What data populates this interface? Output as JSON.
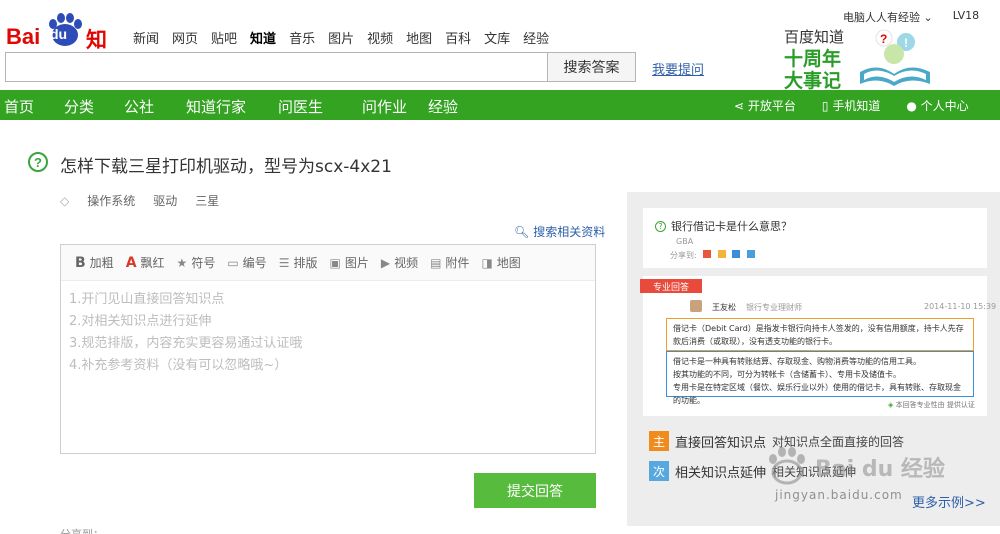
{
  "colors": {
    "brand_red": "#e10602",
    "brand_green": "#33a321",
    "link_blue": "#2f5fa9",
    "submit_green": "#57bc3e"
  },
  "logo": {
    "bai": "Bai",
    "du": "du",
    "zhidao": "知道"
  },
  "top_nav": [
    "新闻",
    "网页",
    "贴吧",
    "知道",
    "音乐",
    "图片",
    "视频",
    "地图",
    "百科",
    "文库",
    "经验"
  ],
  "user": {
    "name": "电脑人人有经验",
    "level": "LV18"
  },
  "search": {
    "button": "搜索答案",
    "ask_link": "我要提问"
  },
  "promo": {
    "line1": "百度知道",
    "line2": "十周年",
    "line3": "大事记"
  },
  "main_nav": [
    "首页",
    "分类",
    "公社",
    "知道行家",
    "问医生",
    "问作业",
    "经验"
  ],
  "right_nav": [
    "开放平台",
    "手机知道",
    "个人中心"
  ],
  "question": {
    "icon": "?",
    "title": "怎样下载三星打印机驱动，型号为scx-4x21",
    "tags": [
      "操作系统",
      "驱动",
      "三星"
    ],
    "search_related": "搜索相关资料"
  },
  "toolbar": [
    {
      "icon": "bold-icon",
      "glyph": "B",
      "label": "加粗"
    },
    {
      "icon": "highlight-icon",
      "glyph": "A",
      "label": "飘红"
    },
    {
      "icon": "star-icon",
      "glyph": "★",
      "label": "符号"
    },
    {
      "icon": "numbering-icon",
      "glyph": "▭",
      "label": "编号"
    },
    {
      "icon": "list-icon",
      "glyph": "☰",
      "label": "排版"
    },
    {
      "icon": "image-icon",
      "glyph": "▣",
      "label": "图片"
    },
    {
      "icon": "video-icon",
      "glyph": "▶",
      "label": "视频"
    },
    {
      "icon": "attachment-icon",
      "glyph": "▤",
      "label": "附件"
    },
    {
      "icon": "map-icon",
      "glyph": "◨",
      "label": "地图"
    }
  ],
  "editor_placeholder": [
    "1.开门见山直接回答知识点",
    "2.对相关知识点进行延伸",
    "3.规范排版，内容充实更容易通过认证哦",
    "4.补充参考资料（没有可以忽略哦~）"
  ],
  "submit": "提交回答",
  "example": {
    "question": "银行借记卡是什么意思？",
    "tag": "GBA",
    "share": "分享到:",
    "badge": "专业回答",
    "answerer": "王友松",
    "answerer_title": "银行专业理财师",
    "date": "2014-11-10 15:39",
    "box1": "借记卡（Debit Card）是指发卡银行向持卡人签发的，没有信用额度，持卡人先存款后消费（或取现），没有透支功能的银行卡。",
    "box2_lines": [
      "借记卡是一种具有转账结算、存取现金、购物消费等功能的信用工具。",
      "按其功能的不同，可分为转帐卡（含储蓄卡）、专用卡及储值卡。",
      "专用卡是在特定区域（餐饮、娱乐行业以外）使用的借记卡，具有转账、存取现金的功能。"
    ],
    "note": "本回答专业性由 提供认证"
  },
  "features": [
    {
      "badge": "主",
      "badge_color": "#f08c1e",
      "title": "直接回答知识点",
      "desc": "对知识点全面直接的回答"
    },
    {
      "badge": "次",
      "badge_color": "#58a8e0",
      "title": "相关知识点延伸",
      "desc": "相关知识点延伸"
    }
  ],
  "more": "更多示例>>",
  "watermark": {
    "text": "Bai du 经验",
    "url": "jingyan.baidu.com"
  },
  "footer_hint": "分享到："
}
